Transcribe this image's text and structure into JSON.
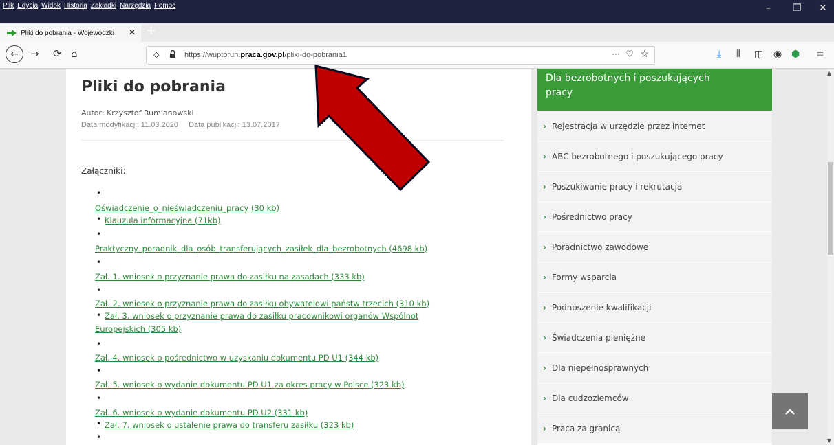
{
  "menu": [
    "Plik",
    "Edycja",
    "Widok",
    "Historia",
    "Zakładki",
    "Narzędzia",
    "Pomoc"
  ],
  "window_controls": {
    "minimize": "–",
    "restore": "❐",
    "close": "✕"
  },
  "tab": {
    "title": "Pliki do pobrania - Wojewódzki",
    "close": "✕"
  },
  "new_tab": "+",
  "url": {
    "prefix": "https://wuptorun.",
    "domain": "praca.gov.pl",
    "path": "/pliki-do-pobrania1"
  },
  "urlbar_icons": [
    "shield-icon",
    "lock-icon",
    "page-actions-icon",
    "pocket-icon",
    "bookmark-star-icon"
  ],
  "article": {
    "title": "Pliki do pobrania",
    "author": "Autor: Krzysztof Rumianowski",
    "modified": "Data modyfikacji: 11.03.2020",
    "published": "Data publikacji: 13.07.2017",
    "attachments_heading": "Załączniki:",
    "attachments": [
      "Oświadczenie_o_nieświadczeniu_pracy (30 kb)",
      "Klauzula informacyjna (71kb)",
      "Praktyczny_poradnik_dla_osób_transferujących_zasiłek_dla_bezrobotnych (4698 kb)",
      "Zał. 1. wniosek o przyznanie prawa do zasiłku na zasadach (333 kb)",
      "Zał. 2. wniosek o przyznanie prawa do zasiłku obywatelowi państw trzecich (310 kb)",
      "Zał. 3. wniosek o przyznanie prawa do zasiłku pracownikowi organów Wspólnot",
      "Europejskich (305 kb)",
      "Zał. 4. wniosek o pośrednictwo w uzyskaniu dokumentu PD U1 (344 kb)",
      "Zał. 5. wniosek o wydanie dokumentu PD U1 za okres pracy w Polsce (323 kb)",
      "Zał. 6. wniosek o wydanie dokumentu PD U2 (331 kb)",
      "Zał. 7. wniosek o ustalenie prawa do transferu zasiłku (323 kb)"
    ]
  },
  "sidebar": {
    "heading": "Dla bezrobotnych i poszukujących pracy",
    "items": [
      "Rejestracja w urzędzie przez internet",
      "ABC bezrobotnego i poszukującego pracy",
      "Poszukiwanie pracy i rekrutacja",
      "Pośrednictwo pracy",
      "Poradnictwo zawodowe",
      "Formy wsparcia",
      "Podnoszenie kwalifikacji",
      "Świadczenia pieniężne",
      "Dla niepełnosprawnych",
      "Dla cudzoziemców",
      "Praca za granicą"
    ]
  },
  "colors": {
    "accent_green": "#3a9d3a",
    "link_green": "#2e8b3a",
    "arrow_red": "#c00000",
    "titlebar": "#202340"
  }
}
